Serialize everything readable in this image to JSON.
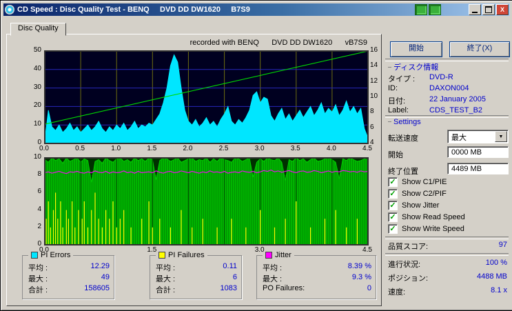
{
  "window": {
    "title": "CD Speed : Disc Quality Test - BENQ     DVD DD DW1620     B7S9",
    "tab": "Disc Quality"
  },
  "chart_header": "recorded with BENQ      DVD DD DW1620      vB7S9",
  "controls": {
    "start": "開始",
    "exit": "終了(X)"
  },
  "disc_info": {
    "title": "ディスク情報",
    "rows": [
      {
        "key": "type",
        "label": "タイプ :",
        "value": "DVD-R"
      },
      {
        "key": "id",
        "label": "ID:",
        "value": "DAXON004"
      },
      {
        "key": "date",
        "label": "日付:",
        "value": "22 January 2005"
      },
      {
        "key": "label",
        "label": "Label:",
        "value": "CDS_TEST_B2"
      }
    ]
  },
  "settings": {
    "title": "Settings",
    "transfer_label": "転送速度",
    "transfer_value": "最大",
    "start_label": "開始",
    "start_value": "0000 MB",
    "end_label": "終了位置",
    "end_value": "4489 MB",
    "checkboxes": [
      {
        "label": "Show C1/PIE",
        "checked": true
      },
      {
        "label": "Show C2/PIF",
        "checked": true
      },
      {
        "label": "Show Jitter",
        "checked": true
      },
      {
        "label": "Show Read Speed",
        "checked": true
      },
      {
        "label": "Show Write Speed",
        "checked": true
      }
    ]
  },
  "quality": {
    "label": "品質スコア:",
    "value": "97"
  },
  "status": [
    {
      "key": "progress",
      "label": "進行状況:",
      "value": "100 %"
    },
    {
      "key": "position",
      "label": "ポジション:",
      "value": "4488 MB"
    },
    {
      "key": "speed",
      "label": "速度:",
      "value": "8.1 x"
    }
  ],
  "legends": [
    {
      "title": "PI Errors",
      "color": "#00e6ff",
      "rows": [
        {
          "label": "平均 :",
          "value": "12.29"
        },
        {
          "label": "最大 :",
          "value": "49"
        },
        {
          "label": "合計 :",
          "value": "158605"
        }
      ]
    },
    {
      "title": "PI Failures",
      "color": "#ffff00",
      "rows": [
        {
          "label": "平均 :",
          "value": "0.11"
        },
        {
          "label": "最大 :",
          "value": "6"
        },
        {
          "label": "合計 :",
          "value": "1083"
        }
      ]
    },
    {
      "title": "Jitter",
      "color": "#ff00ff",
      "rows": [
        {
          "label": "平均 :",
          "value": "8.39 %"
        },
        {
          "label": "最大 :",
          "value": "9.3 %"
        },
        {
          "label": "PO Failures:",
          "value": "0"
        }
      ]
    }
  ],
  "chart_data": [
    {
      "type": "area",
      "title": "PI Errors / Read Speed",
      "x_min": 0,
      "x_max": 4.5,
      "v_grid_step": 0.5,
      "grid_over": false,
      "x_ticks": [
        0,
        0.5,
        1.0,
        1.5,
        2.0,
        2.5,
        3.0,
        3.5,
        4.0,
        4.5
      ],
      "y_left": {
        "label": "PI Errors",
        "min": 0,
        "max": 50,
        "ticks": [
          0,
          10,
          20,
          30,
          40,
          50
        ]
      },
      "y_right": {
        "label": "Read Speed",
        "min": 4,
        "max": 16,
        "ticks": [
          4,
          6,
          8,
          10,
          12,
          14,
          16
        ]
      },
      "bg": "#000020",
      "grid": {
        "h_color": "#2828bc",
        "v_color": "#6e6e10"
      },
      "series": [
        {
          "name": "PI Errors",
          "style": "area",
          "color": "#00e6ff",
          "stroke": "#00f0ff",
          "x_start": 0,
          "x_step": 0.05,
          "values": [
            2,
            18,
            9,
            7,
            10,
            6,
            8,
            11,
            7,
            9,
            6,
            8,
            10,
            7,
            9,
            12,
            8,
            6,
            9,
            7,
            10,
            8,
            11,
            7,
            9,
            12,
            8,
            10,
            9,
            11,
            10,
            13,
            16,
            22,
            30,
            42,
            48,
            44,
            30,
            18,
            12,
            10,
            13,
            9,
            11,
            14,
            10,
            12,
            9,
            13,
            16,
            20,
            12,
            10,
            13,
            11,
            14,
            18,
            26,
            28,
            22,
            25,
            24,
            15,
            12,
            16,
            19,
            13,
            16,
            12,
            15,
            18,
            14,
            17,
            20,
            15,
            18,
            22,
            16,
            19,
            17,
            21,
            15,
            18,
            23,
            17,
            20,
            16,
            19,
            8,
            3
          ]
        },
        {
          "name": "Read Speed",
          "style": "line",
          "axis": "right",
          "color": "#00dc00",
          "points": [
            [
              0,
              6.5
            ],
            [
              4.5,
              16
            ]
          ]
        }
      ]
    },
    {
      "type": "area",
      "title": "PI Failures / Jitter",
      "x_min": 0,
      "x_max": 4.5,
      "v_grid_step": 0.5,
      "grid_over": true,
      "x_ticks": [
        0,
        1.5,
        3.0,
        4.5
      ],
      "y_left": {
        "label": "PI Failures / Jitter",
        "min": 0,
        "max": 10,
        "ticks": [
          0,
          2,
          4,
          6,
          8,
          10
        ]
      },
      "bg": "#003000",
      "grid": {
        "h_color": "#005a00",
        "v_color": "#004a00"
      },
      "series": [
        {
          "name": "Scan Fill",
          "style": "area",
          "color": "#00b400",
          "stroke": "#00d400",
          "textured": true,
          "x_start": 0,
          "x_step": 0.05,
          "values": [
            9.8,
            9.5,
            10,
            9.7,
            9.9,
            9.4,
            10,
            9.6,
            9.8,
            10,
            9.5,
            9.9,
            9.7,
            7.2,
            9.6,
            9.8,
            9.4,
            10,
            9.7,
            9.5,
            9.9,
            10,
            9.6,
            9.8,
            9.5,
            10,
            9.7,
            9.9,
            9.6,
            10,
            9.8,
            7.5,
            9.7,
            10,
            9.9,
            9.6,
            9.8,
            10,
            9.5,
            9.7,
            9.9,
            10,
            9.6,
            9.8,
            9.7,
            10,
            9.5,
            9.9,
            9.6,
            10,
            9.8,
            9.7,
            9.5,
            10,
            9.9,
            9.6,
            9.8,
            10,
            7.8,
            9.5,
            9.9,
            9.6,
            10,
            9.8,
            9.7,
            10,
            9.5,
            7.4,
            9.8,
            9.6,
            10,
            9.7,
            9.9,
            9.5,
            9.8,
            10,
            9.6,
            9.7,
            9.9,
            10,
            9.8,
            9.5,
            7.6,
            9.9,
            9.7,
            10,
            9.8,
            9.6,
            9.7,
            9.9,
            9.8
          ]
        },
        {
          "name": "PI Failures",
          "style": "spikes",
          "color": "#ffff00",
          "points": [
            [
              0.02,
              3
            ],
            [
              0.05,
              5
            ],
            [
              0.08,
              2
            ],
            [
              0.12,
              4
            ],
            [
              0.15,
              6
            ],
            [
              0.18,
              3
            ],
            [
              0.22,
              5
            ],
            [
              0.25,
              2
            ],
            [
              0.3,
              4
            ],
            [
              0.33,
              3
            ],
            [
              0.38,
              5
            ],
            [
              0.42,
              2
            ],
            [
              0.47,
              4
            ],
            [
              0.52,
              3
            ],
            [
              0.55,
              5
            ],
            [
              0.6,
              2
            ],
            [
              0.65,
              4
            ],
            [
              0.7,
              6
            ],
            [
              0.75,
              3
            ],
            [
              0.8,
              2
            ],
            [
              0.85,
              4
            ],
            [
              0.9,
              3
            ],
            [
              0.95,
              5
            ],
            [
              1.0,
              2
            ],
            [
              1.05,
              3
            ],
            [
              1.1,
              4
            ],
            [
              1.2,
              2
            ],
            [
              1.35,
              3
            ],
            [
              1.45,
              5
            ],
            [
              1.5,
              2
            ],
            [
              1.6,
              3
            ],
            [
              1.75,
              2
            ],
            [
              1.9,
              4
            ],
            [
              2.05,
              2
            ],
            [
              2.2,
              3
            ],
            [
              2.4,
              2
            ],
            [
              2.6,
              3
            ],
            [
              2.8,
              2
            ],
            [
              3.0,
              4
            ],
            [
              3.2,
              2
            ],
            [
              3.35,
              3
            ],
            [
              3.5,
              5
            ],
            [
              3.7,
              2
            ],
            [
              3.9,
              3
            ],
            [
              4.05,
              4
            ],
            [
              4.2,
              2
            ],
            [
              4.35,
              3
            ]
          ]
        },
        {
          "name": "Jitter",
          "style": "line",
          "color": "#ff00ff",
          "x_start": 0,
          "x_step": 0.05,
          "values": [
            8.3,
            8.4,
            8.25,
            8.35,
            8.45,
            8.3,
            8.2,
            8.4,
            8.35,
            8.45,
            8.3,
            8.25,
            8.4,
            8.3,
            8.5,
            8.35,
            8.3,
            8.45,
            8.25,
            8.4,
            8.3,
            8.35,
            8.5,
            8.3,
            8.4,
            8.25,
            8.45,
            8.3,
            8.35,
            8.4,
            8.3,
            8.5,
            8.35,
            8.25,
            8.4,
            8.45,
            8.3,
            8.35,
            8.5,
            8.4,
            8.3,
            8.45,
            8.35,
            8.25,
            8.4,
            8.3,
            8.5,
            8.35,
            8.4,
            8.3,
            8.45,
            8.25,
            8.35,
            8.4,
            8.3,
            8.5,
            8.4,
            8.35,
            8.45,
            8.3,
            8.4,
            8.55,
            8.45,
            8.6,
            8.4,
            8.5,
            8.35,
            8.45,
            8.55,
            8.4,
            8.3,
            8.45,
            8.5,
            8.35,
            8.4,
            8.55,
            8.45,
            8.3,
            8.4,
            8.5,
            8.35,
            8.45,
            8.4,
            8.55,
            8.5,
            8.4,
            8.45,
            8.35,
            8.5,
            8.4,
            8.45
          ]
        }
      ]
    }
  ]
}
